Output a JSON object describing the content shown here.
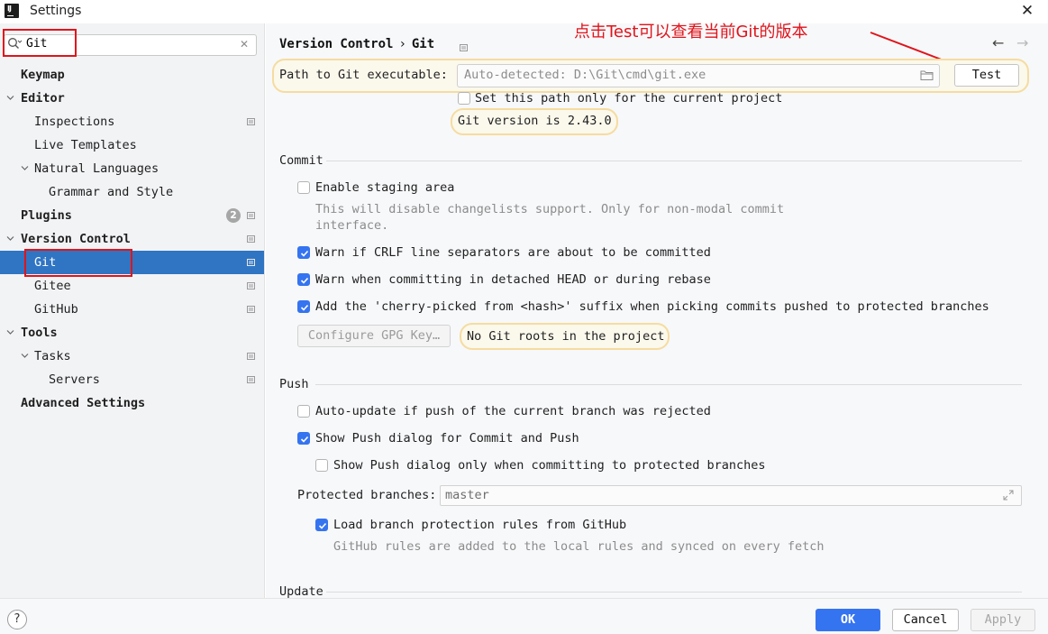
{
  "window": {
    "title": "Settings",
    "app_icon_text": "IJ"
  },
  "search": {
    "value": "Git"
  },
  "sidebar": {
    "items": [
      {
        "label": "Keymap"
      },
      {
        "label": "Editor"
      },
      {
        "label": "Inspections"
      },
      {
        "label": "Live Templates"
      },
      {
        "label": "Natural Languages"
      },
      {
        "label": "Grammar and Style"
      },
      {
        "label": "Plugins",
        "badge": "2"
      },
      {
        "label": "Version Control"
      },
      {
        "label": "Git"
      },
      {
        "label": "Gitee"
      },
      {
        "label": "GitHub"
      },
      {
        "label": "Tools"
      },
      {
        "label": "Tasks"
      },
      {
        "label": "Servers"
      },
      {
        "label": "Advanced Settings"
      }
    ]
  },
  "header": {
    "breadcrumb_parent": "Version Control",
    "breadcrumb_sep": "›",
    "breadcrumb_current": "Git"
  },
  "annotation": {
    "text": "点击Test可以查看当前Git的版本",
    "color": "#e0141b"
  },
  "git_path": {
    "label": "Path to Git executable:",
    "placeholder": "Auto-detected: D:\\Git\\cmd\\git.exe",
    "test_button": "Test",
    "project_only_label": "Set this path only for the current project",
    "version_text": "Git version is 2.43.0"
  },
  "commit": {
    "title": "Commit",
    "enable_staging": {
      "label": "Enable staging area",
      "checked": false
    },
    "staging_hint_1": "This will disable changelists support. Only for non-modal commit",
    "staging_hint_2": "interface.",
    "warn_crlf": {
      "label": "Warn if CRLF line separators are about to be committed",
      "checked": true
    },
    "warn_detached": {
      "label": "Warn when committing in detached HEAD or during rebase",
      "checked": true
    },
    "cherry_pick": {
      "label": "Add the 'cherry-picked from <hash>' suffix when picking commits pushed to protected branches",
      "checked": true
    },
    "gpg_button": "Configure GPG Key…",
    "no_roots": "No Git roots in the project"
  },
  "push": {
    "title": "Push",
    "auto_update": {
      "label": "Auto-update if push of the current branch was rejected",
      "checked": false
    },
    "show_dialog": {
      "label": "Show Push dialog for Commit and Push",
      "checked": true
    },
    "show_dialog_protected": {
      "label": "Show Push dialog only when committing to protected branches",
      "checked": false
    },
    "protected_label": "Protected branches:",
    "protected_value": "master",
    "load_rules": {
      "label": "Load branch protection rules from GitHub",
      "checked": true
    },
    "rules_hint": "GitHub rules are added to the local rules and synced on every fetch"
  },
  "update": {
    "title": "Update"
  },
  "footer": {
    "help": "?",
    "ok": "OK",
    "cancel": "Cancel",
    "apply": "Apply"
  },
  "colors": {
    "accent": "#3574f0",
    "selection": "#2f75c3",
    "highlight_border": "#f5dca0",
    "red_box": "#e0141b"
  }
}
